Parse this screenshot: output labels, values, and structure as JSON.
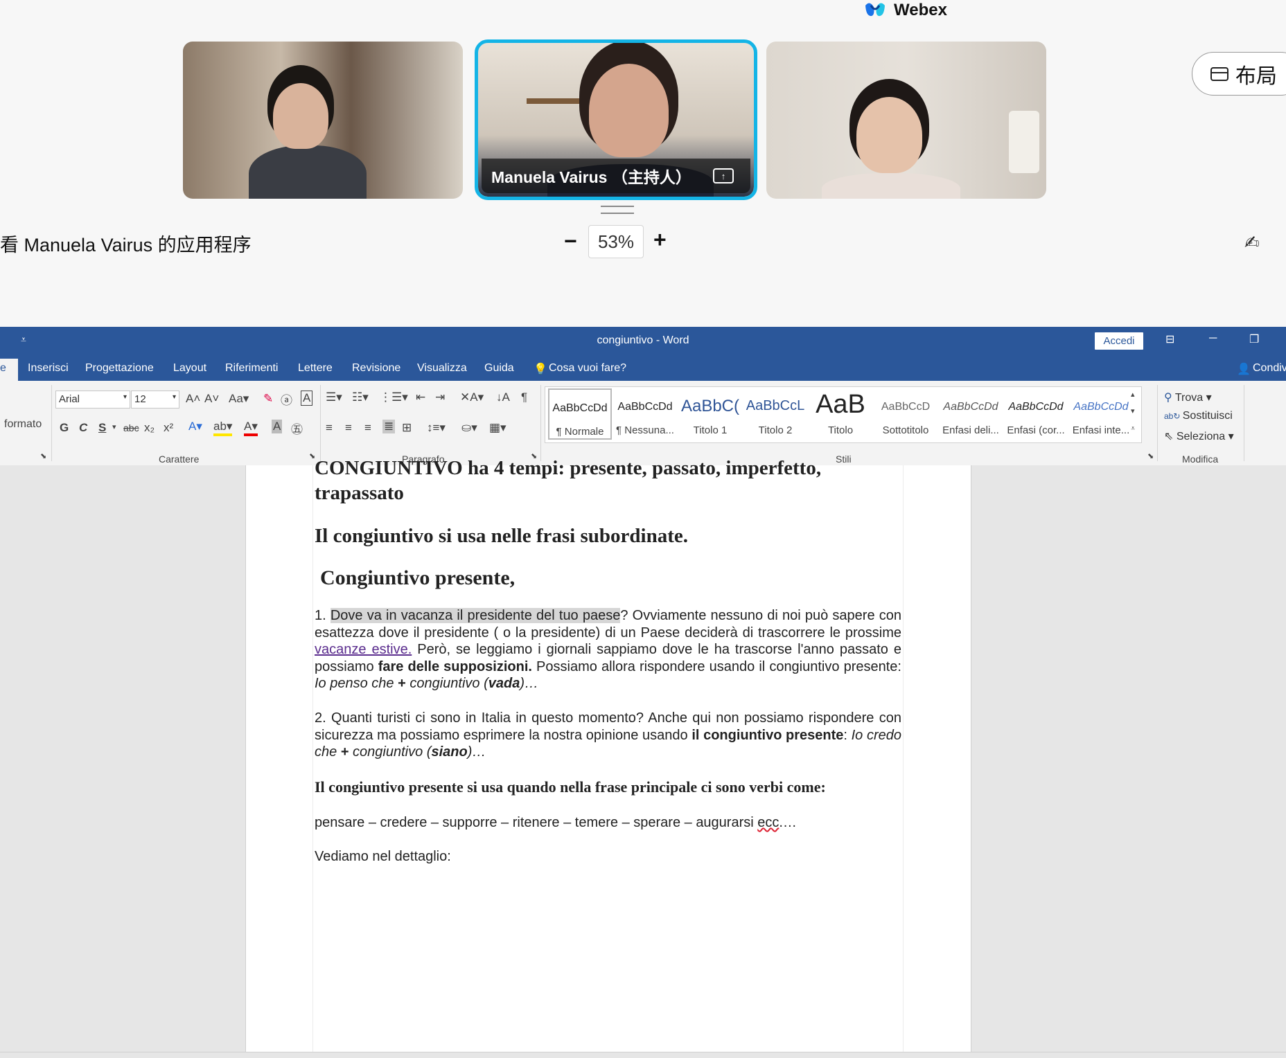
{
  "webex": {
    "app_name": "Webex",
    "host_name": "Manuela Vairus （主持人）",
    "layout_label": "布局",
    "sharing_label": "看 Manuela Vairus 的应用程序",
    "zoom_minus": "−",
    "zoom_value": "53%",
    "zoom_plus": "+"
  },
  "word": {
    "title": "congiuntivo  -  Word",
    "accedi": "Accedi",
    "tabs": {
      "partial": "e",
      "inserisci": "Inserisci",
      "progettazione": "Progettazione",
      "layout": "Layout",
      "riferimenti": "Riferimenti",
      "lettere": "Lettere",
      "revisione": "Revisione",
      "visualizza": "Visualizza",
      "guida": "Guida",
      "tell_me": "Cosa vuoi fare?",
      "share": "Condiv"
    },
    "ribbon": {
      "clipboard_format": "formato",
      "font_name": "Arial",
      "font_size": "12",
      "group_carattere": "Carattere",
      "group_paragrafo": "Paragrafo",
      "group_stili": "Stili",
      "group_modifica": "Modifica",
      "btn_g": "G",
      "btn_c": "C",
      "btn_s": "S",
      "styles": [
        {
          "preview": "AaBbCcDd",
          "name": "¶ Normale"
        },
        {
          "preview": "AaBbCcDd",
          "name": "¶ Nessuna..."
        },
        {
          "preview": "AaBbC(",
          "name": "Titolo 1"
        },
        {
          "preview": "AaBbCcL",
          "name": "Titolo 2"
        },
        {
          "preview": "AaB",
          "name": "Titolo"
        },
        {
          "preview": "AaBbCcD",
          "name": "Sottotitolo"
        },
        {
          "preview": "AaBbCcDd",
          "name": "Enfasi deli..."
        },
        {
          "preview": "AaBbCcDd",
          "name": "Enfasi (cor..."
        },
        {
          "preview": "AaBbCcDd",
          "name": "Enfasi inte..."
        }
      ],
      "trova": "Trova",
      "sostituisci": "Sostituisci",
      "seleziona": "Seleziona"
    },
    "document": {
      "cut_heading_line1": "CONGIUNTIVO ha 4 tempi: presente, passato, imperfetto,",
      "cut_heading_line2": "trapassato",
      "heading2": "Il congiuntivo si usa nelle frasi subordinate.",
      "heading3": "Congiuntivo presente,",
      "p1_num": " 1. ",
      "p1_highlight": "Dove va in vacanza il presidente del tuo paese",
      "p1_a": "? Ovviamente nessuno di noi può sapere con esattezza dove il presidente ( o la presidente) di un Paese deciderà di trascorrere le prossime",
      "p1_link": " vacanze estive.",
      "p1_b": " Però, se leggiamo i giornali sappiamo dove le ha trascorse l'anno passato e possiamo ",
      "p1_bold": "fare delle supposizioni.",
      "p1_c": " Possiamo allora rispondere usando il congiuntivo presente: ",
      "p1_ital": "Io penso che ",
      "p1_plus": "+",
      "p1_ital2": " congiuntivo (",
      "p1_vada": "vada",
      "p1_end": ")…",
      "p2_a": " 2. Quanti turisti ci sono in Italia in questo momento? Anche qui non possiamo rispondere con sicurezza ma possiamo esprimere la nostra opinione usando ",
      "p2_bold": "il congiuntivo presente",
      "p2_b": ": ",
      "p2_ital": "Io credo che ",
      "p2_plus": "+",
      "p2_ital2": " congiuntivo (",
      "p2_siano": "siano",
      "p2_end": ")…",
      "heading4": "Il congiuntivo presente si usa quando nella frase principale ci sono verbi come:",
      "verbs": "pensare – credere – supporre – ritenere – temere – sperare – augurarsi ",
      "verbs_ecc": "ecc",
      "verbs_end": ".…",
      "vediamo": "Vediamo nel dettaglio:"
    }
  },
  "colors": {
    "word_blue": "#2b579a",
    "active_speaker": "#14b4e6",
    "link_purple": "#5b2d8e"
  }
}
